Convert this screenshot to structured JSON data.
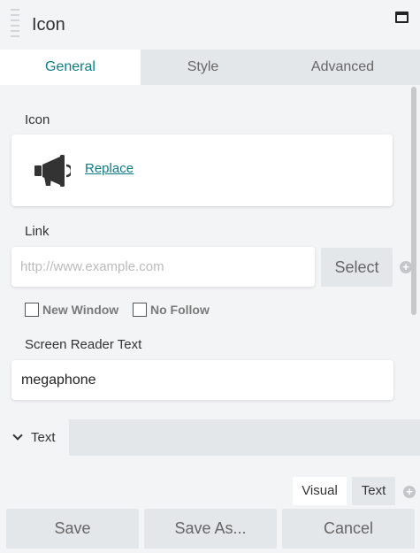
{
  "header": {
    "title": "Icon"
  },
  "tabs": [
    {
      "label": "General",
      "active": true
    },
    {
      "label": "Style",
      "active": false
    },
    {
      "label": "Advanced",
      "active": false
    }
  ],
  "icon_field": {
    "label": "Icon",
    "icon": "megaphone-icon",
    "replace_label": "Replace"
  },
  "link_field": {
    "label": "Link",
    "placeholder": "http://www.example.com",
    "select_label": "Select",
    "new_window_label": "New Window",
    "no_follow_label": "No Follow"
  },
  "screen_reader_field": {
    "label": "Screen Reader Text",
    "value": "megaphone"
  },
  "text_section": {
    "label": "Text",
    "collapsed": false
  },
  "editor_tabs": {
    "visual_label": "Visual",
    "text_label": "Text"
  },
  "footer": {
    "save_label": "Save",
    "save_as_label": "Save As...",
    "cancel_label": "Cancel"
  },
  "colors": {
    "accent": "#0e7c86",
    "panel_bg": "#f3f4f5",
    "tab_bg": "#e4e7ea"
  }
}
